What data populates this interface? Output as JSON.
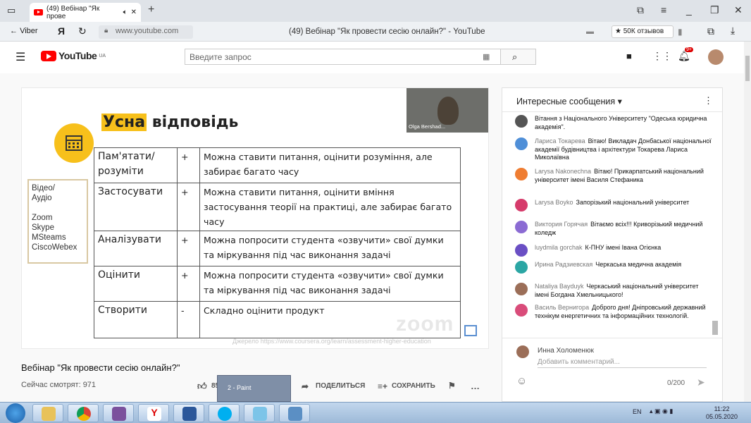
{
  "browser": {
    "tab_title": "(49) Вебінар \"Як прове",
    "back_label": "Viber",
    "ya_label": "Я",
    "url": "www.youtube.com",
    "page_title": "(49) Вебінар \"Як провести сесію онлайн?\" - YouTube",
    "reviews_label": "★ 50К отзывов"
  },
  "youtube": {
    "logo_text": "YouTube",
    "logo_region": "UA",
    "search_placeholder": "Введите запрос",
    "notif_count": "9+"
  },
  "slide": {
    "title_highlight": "Усна",
    "title_rest": " відповідь",
    "left_box": [
      "Відео/",
      "Аудіо",
      "",
      "Zoom",
      "Skype",
      "MSteams",
      "CiscoWebex"
    ],
    "rows": [
      {
        "action": "Пам'ятати/ розуміти",
        "sign": "+",
        "note": "Можна ставити питання, оцінити розуміння, але забирає багато часу"
      },
      {
        "action": "Застосувати",
        "sign": "+",
        "note": "Можна ставити питання, оцінити вміння застосування теорії на практиці, але забирає багато часу"
      },
      {
        "action": "Аналізувати",
        "sign": "+",
        "note": "Можна попросити студента «озвучити» свої думки та міркування під час виконання задачі"
      },
      {
        "action": "Оцінити",
        "sign": "+",
        "note": "Можна попросити студента «озвучити» свої думки та міркування під час виконання задачі"
      },
      {
        "action": "Створити",
        "sign": "-",
        "note": "Складно оцінити продукт"
      }
    ],
    "speaker_name": "Olga Bershad...",
    "watermark": "zoom",
    "source": "Джерело https://www.coursera.org/learn/assessment-higher-education"
  },
  "video": {
    "title": "Вебінар \"Як провести сесію онлайн?\"",
    "viewers": "Сейчас смотрят: 971",
    "likes": "85",
    "share_label": "ПОДЕЛИТЬСЯ",
    "save_label": "СОХРАНИТЬ",
    "paint_label": "2 - Paint"
  },
  "chat": {
    "header": "Интересные сообщения",
    "messages": [
      {
        "author": "",
        "text": "Вітання з Національного Університету \"Одеська юридична академія\".",
        "color": "#555555"
      },
      {
        "author": "Лариса Токарева",
        "text": "Вітаю! Викладач Донбаської національної академії будівництва і архітектури Токарева Лариса Миколаївна",
        "color": "#4f8fd8"
      },
      {
        "author": "Larysa Nakonechna",
        "text": "Вітаю! Прикарпатський національний університет імені Василя Стефаника",
        "color": "#ef7d32"
      },
      {
        "author": "Larysa Boyko",
        "text": "Запорізький національний університет",
        "color": "#d63b6b"
      },
      {
        "author": "Виктория Горячая",
        "text": "Вітаємо всіх!!! Криворізький медичний коледж",
        "color": "#8b6bd3"
      },
      {
        "author": "luydmila gorchak",
        "text": "К-ПНУ імені Івана Огієнка",
        "color": "#6a4fc4"
      },
      {
        "author": "Ирина Радзиевская",
        "text": "Черкаська медична академія",
        "color": "#2ba6a4"
      },
      {
        "author": "Nataliya Bayduyk",
        "text": "Черкаський національний університет імені Богдана Хмельницького!",
        "color": "#9b6e58"
      },
      {
        "author": "Василь Вернигора",
        "text": "Доброго дня! Дніпровський державний технікум енергетичних та інформаційних технологій.",
        "color": "#d94c7a"
      }
    ],
    "me_name": "Инна Холоменюк",
    "input_placeholder": "Добавить комментарий...",
    "counter": "0/200"
  },
  "taskbar": {
    "lang": "EN",
    "time": "11:22",
    "date": "05.05.2020"
  }
}
